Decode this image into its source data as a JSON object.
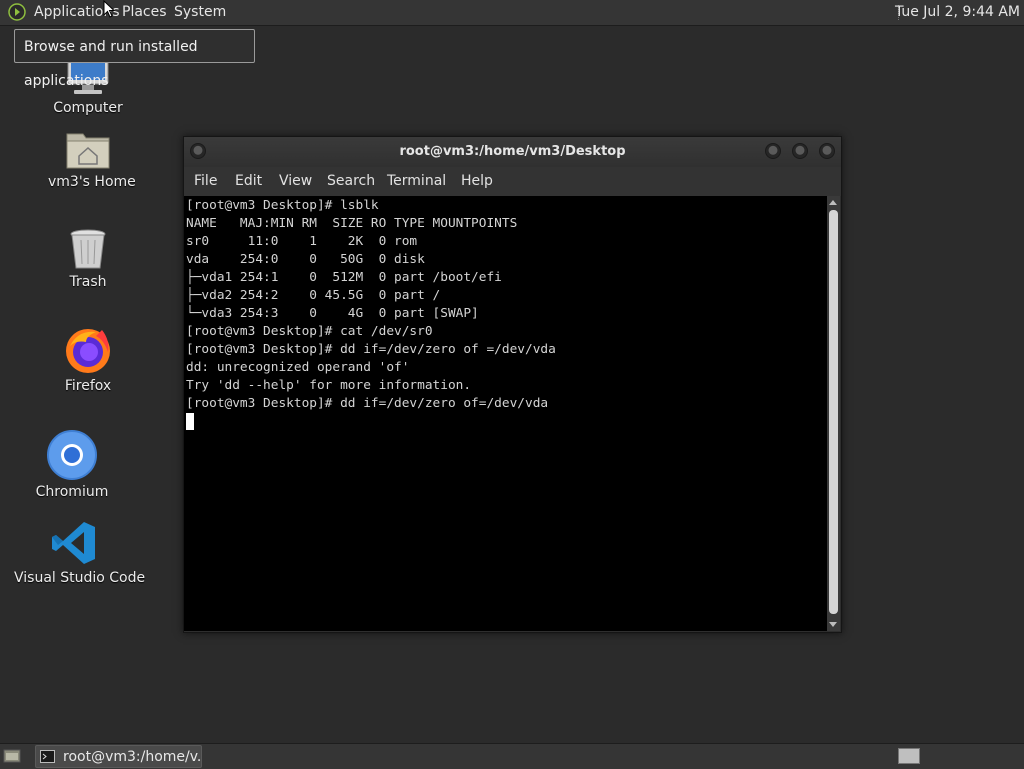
{
  "top_panel": {
    "menus": [
      "Applications",
      "Places",
      "System"
    ],
    "clock": "Tue Jul  2,  9:44 AM"
  },
  "tooltip": "Browse and run installed applications",
  "desktop_icons": [
    {
      "label": "Computer",
      "icon": "computer-icon"
    },
    {
      "label": "vm3's Home",
      "icon": "home-folder-icon"
    },
    {
      "label": "Trash",
      "icon": "trash-icon"
    },
    {
      "label": "Firefox",
      "icon": "firefox-icon"
    },
    {
      "label": "Chromium",
      "icon": "chromium-icon"
    },
    {
      "label": "Visual Studio Code",
      "icon": "vscode-icon"
    }
  ],
  "terminal": {
    "title": "root@vm3:/home/vm3/Desktop",
    "menu": [
      "File",
      "Edit",
      "View",
      "Search",
      "Terminal",
      "Help"
    ],
    "output": "[root@vm3 Desktop]# lsblk\nNAME   MAJ:MIN RM  SIZE RO TYPE MOUNTPOINTS\nsr0     11:0    1    2K  0 rom\nvda    254:0    0   50G  0 disk\n├─vda1 254:1    0  512M  0 part /boot/efi\n├─vda2 254:2    0 45.5G  0 part /\n└─vda3 254:3    0    4G  0 part [SWAP]\n[root@vm3 Desktop]# cat /dev/sr0\n[root@vm3 Desktop]# dd if=/dev/zero of =/dev/vda\ndd: unrecognized operand 'of'\nTry 'dd --help' for more information.\n[root@vm3 Desktop]# dd if=/dev/zero of=/dev/vda\n"
  },
  "taskbar": {
    "window_button": "root@vm3:/home/v..."
  },
  "colors": {
    "desktop_bg": "#2b2b2b",
    "panel_bg": "#353535",
    "terminal_bg": "#000000",
    "terminal_fg": "#d4d4d4"
  }
}
